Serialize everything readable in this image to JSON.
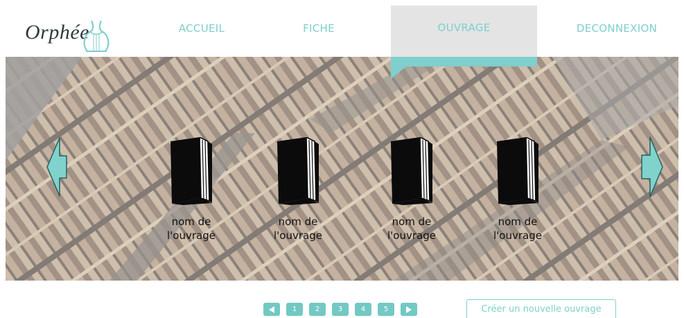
{
  "brand": {
    "name": "Orphée"
  },
  "nav": {
    "accueil": "ACCUEIL",
    "fiche": "FICHE",
    "ouvrage": "OUVRAGE",
    "deconnexion": "DECONNEXION",
    "active": "OUVRAGE"
  },
  "colors": {
    "accent": "#7ecfcd",
    "accent_dark": "#72c9c3",
    "active_tab": "#e4e4e4",
    "book": "#0b0b0b"
  },
  "carousel": {
    "prev_icon": "arrow-left-icon",
    "next_icon": "arrow-right-icon",
    "books": [
      {
        "label": "nom de\nl'ouvrage",
        "icon": "book-icon"
      },
      {
        "label": "nom de\nl'ouvrage",
        "icon": "book-icon"
      },
      {
        "label": "nom de\nl'ouvrage",
        "icon": "book-icon"
      },
      {
        "label": "nom de\nl'ouvrage",
        "icon": "book-icon"
      }
    ]
  },
  "pagination": {
    "prev_icon": "triangle-left-icon",
    "next_icon": "triangle-right-icon",
    "pages": [
      "1",
      "2",
      "3",
      "4",
      "5"
    ]
  },
  "actions": {
    "create_label": "Créer un nouvelle ouvrage"
  }
}
